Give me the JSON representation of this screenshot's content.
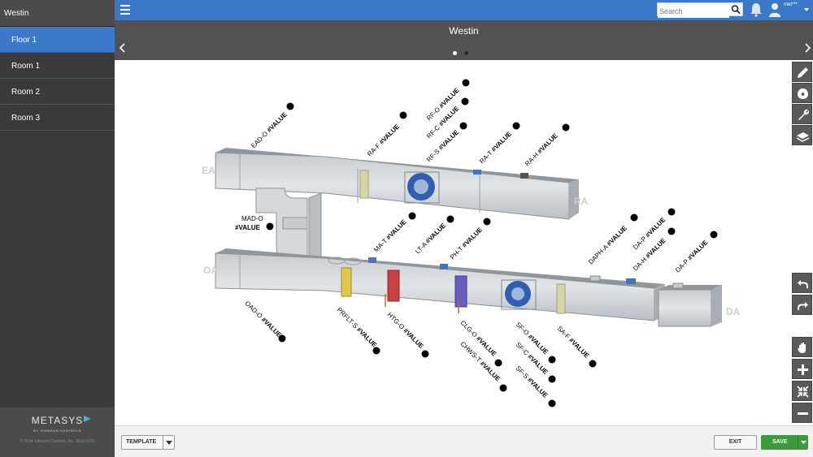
{
  "sidebar": {
    "title": "Westin",
    "items": [
      {
        "label": "Floor 1",
        "active": true
      },
      {
        "label": "Room 1",
        "active": false
      },
      {
        "label": "Room 2",
        "active": false
      },
      {
        "label": "Room 3",
        "active": false
      }
    ],
    "logo": "METASYS",
    "logo_sub": "BY JOHNSON CONTROLS",
    "copyright": "© 2014 Johnson Controls, Inc. 2013-2015"
  },
  "header": {
    "search_placeholder": "Search",
    "username": "met***",
    "accent_color": "#3c78c8"
  },
  "page": {
    "title": "Westin",
    "pager": {
      "count": 2,
      "active": 1
    }
  },
  "diagram": {
    "value_text": "#VALUE",
    "zones": {
      "ea": "EA",
      "ra": "RA",
      "oa": "OA",
      "da": "DA"
    },
    "points": {
      "ead_o": "EAD-O",
      "ra_f": "RA-F",
      "rf_o": "RF-O",
      "rf_c": "RF-C",
      "rf_s": "RF-S",
      "ra_t": "RA-T",
      "ra_h": "RA-H",
      "mad_o": "MAD-O",
      "ma_t": "MA-T",
      "lt_a": "LT-A",
      "ph_t": "PH-T",
      "daph_a": "DAPH-A",
      "da_p1": "DA-P",
      "da_h": "DA-H",
      "da_p2": "DA-P",
      "oad_o": "OAD-O",
      "prflt_s": "PRFLT-S",
      "htg_o": "HTG-O",
      "clg_o": "CLG-O",
      "chws_t": "CHWS-T",
      "sf_o": "SF-O",
      "sf_c": "SF-C",
      "sf_s": "SF-S",
      "sa_f": "SA-F"
    }
  },
  "toolbar": {
    "icons": [
      "pencil-icon",
      "shape-icon",
      "wrench-icon",
      "layers-icon",
      "undo-icon",
      "redo-icon",
      "hand-icon",
      "zoom-in-icon",
      "fit-icon",
      "zoom-out-icon"
    ]
  },
  "bottom": {
    "template_label": "TEMPLATE",
    "exit_label": "EXIT",
    "save_label": "SAVE",
    "save_color": "#3c9a3c"
  }
}
